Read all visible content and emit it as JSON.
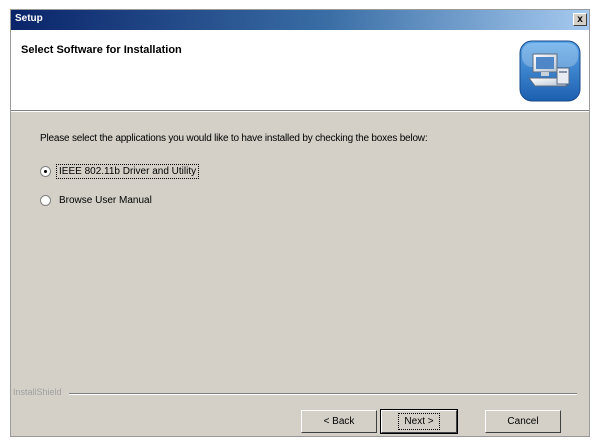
{
  "window": {
    "title": "Setup",
    "close_glyph": "x"
  },
  "header": {
    "title": "Select Software for Installation",
    "icon": "computer-install-icon"
  },
  "body": {
    "instruction": "Please select the applications you would like to have installed by checking the boxes below:",
    "options": [
      {
        "label": "IEEE 802.11b Driver and Utility",
        "selected": true
      },
      {
        "label": "Browse User Manual",
        "selected": false
      }
    ]
  },
  "footer": {
    "brand": "InstallShield",
    "buttons": {
      "back": "< Back",
      "next": "Next >",
      "cancel": "Cancel"
    }
  },
  "colors": {
    "titlebar_start": "#0a246a",
    "titlebar_end": "#a6caf0",
    "dialog_face": "#d4d0c8"
  }
}
